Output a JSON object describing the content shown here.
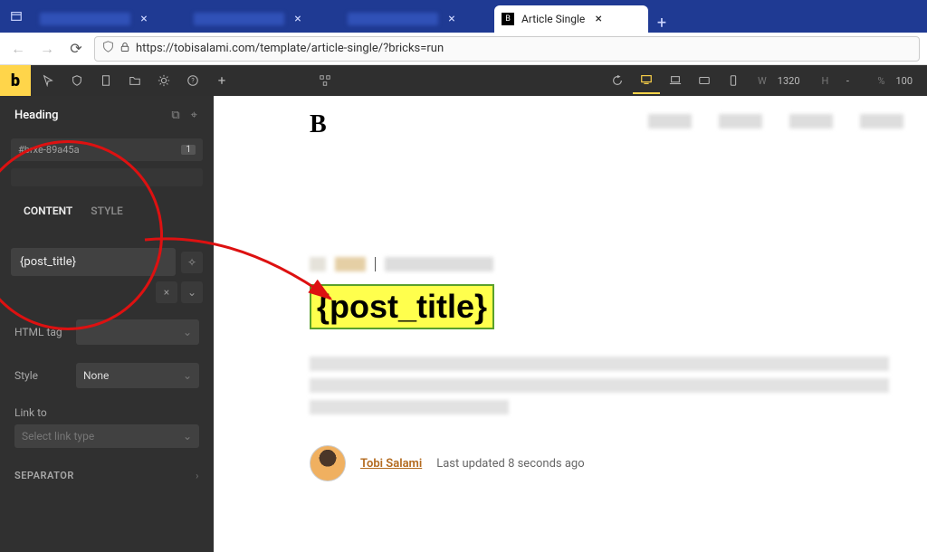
{
  "browser": {
    "active_tab_title": "Article Single",
    "url": "https://tobisalami.com/template/article-single/?bricks=run"
  },
  "bricks_bar": {
    "logo": "b",
    "width_label": "W",
    "width_value": "1320",
    "height_label": "H",
    "height_value": "-",
    "percent_label": "%",
    "percent_value": "100"
  },
  "sidebar": {
    "element_title": "Heading",
    "element_id": "#brxe-89a45a",
    "element_id_count": "1",
    "tabs": {
      "content": "CONTENT",
      "style": "STYLE"
    },
    "fields": {
      "title_value": "{post_title}",
      "html_tag_label": "HTML tag",
      "html_tag_value": "",
      "style_label": "Style",
      "style_value": "None",
      "linkto_label": "Link to",
      "linkto_placeholder": "Select link type"
    },
    "separator_label": "SEPARATOR"
  },
  "canvas": {
    "site_logo": "B",
    "post_title_display": "{post_title}",
    "author_name": "Tobi Salami",
    "last_updated": "Last updated 8 seconds ago"
  }
}
